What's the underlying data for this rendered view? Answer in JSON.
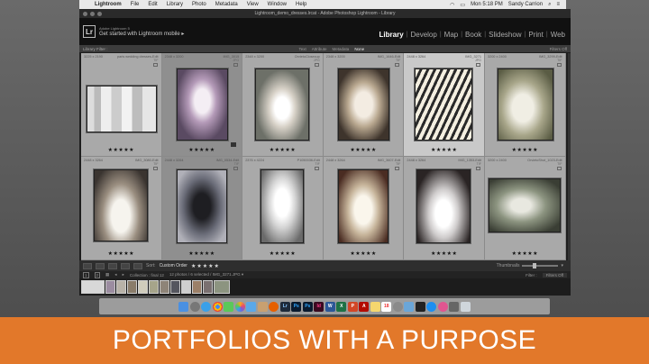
{
  "menubar": {
    "items": [
      "Lightroom",
      "File",
      "Edit",
      "Library",
      "Photo",
      "Metadata",
      "View",
      "Window",
      "Help"
    ],
    "clock": "Mon 5:18 PM",
    "user": "Sandy Carrion"
  },
  "window": {
    "title": "Lightroom_demo_dresses.lrcat - Adobe Photoshop Lightroom - Library"
  },
  "identity": {
    "logo": "Lr",
    "line1": "Adobe Lightroom 5",
    "line2": "Get started with Lightroom mobile ▸"
  },
  "modules": [
    "Library",
    "Develop",
    "Map",
    "Book",
    "Slideshow",
    "Print",
    "Web"
  ],
  "active_module": "Library",
  "filterbar": {
    "title": "Library Filter :",
    "options": [
      "Text",
      "Attribute",
      "Metadata",
      "None"
    ],
    "active": "None",
    "preset": "Filters Off"
  },
  "grid": {
    "cells": [
      {
        "name": "paris wedding dresses-Edit",
        "dims": "3225 x 2190",
        "ext": "TIF",
        "stars": "★★★★★"
      },
      {
        "name": "IMG_3015",
        "dims": "2348 x 3200",
        "ext": "JPG",
        "stars": "★★★★★"
      },
      {
        "name": "OrvietoClosecup",
        "dims": "2348 x 3200",
        "ext": "JPG",
        "stars": "★★★★★"
      },
      {
        "name": "IMG_1646-Edit",
        "dims": "2348 x 3200",
        "ext": "TIF",
        "stars": "★★★★★"
      },
      {
        "name": "IMG_3271",
        "dims": "2448 x 3264",
        "ext": "JPG",
        "stars": "★★★★★"
      },
      {
        "name": "IMG_3299-Edit",
        "dims": "3200 x 2400",
        "ext": "TIF",
        "stars": "★★★★★"
      },
      {
        "name": "IMG_3080-Edit",
        "dims": "2448 x 3264",
        "ext": "TIF",
        "stars": "★★★★★"
      },
      {
        "name": "IMG_0534-Edit",
        "dims": "2448 x 3264",
        "ext": "TIF",
        "stars": "★★★★★"
      },
      {
        "name": "P1050036-Edit",
        "dims": "2376 x 4224",
        "ext": "TIF",
        "stars": "★★★★★"
      },
      {
        "name": "IMG_3607-Edit",
        "dims": "2448 x 3264",
        "ext": "TIF",
        "stars": "★★★★★"
      },
      {
        "name": "IMG_1353-Edit",
        "dims": "2448 x 3264",
        "ext": "TIF",
        "stars": "★★★★★"
      },
      {
        "name": "OrvietoShot_1023-Edit",
        "dims": "3200 x 2400",
        "ext": "TIF",
        "stars": "★★★★★"
      }
    ]
  },
  "toolbar": {
    "sort_label": "Sort:",
    "sort_value": "Custom Order",
    "rating": "★★★★★",
    "thumbnails_label": "Thumbnails"
  },
  "filmstrip": {
    "pages": [
      "1",
      "2"
    ],
    "collection": "Collection : final 12",
    "status": "12 photos / 6 selected / IMG_3271.JPG ▾",
    "filter_label": "Filter :",
    "filter_value": "Filters Off"
  },
  "dock_icons": [
    "Finder",
    "Launchpad",
    "Safari",
    "Chrome",
    "Messages",
    "Photos",
    "Mail",
    "Contacts",
    "Firefox",
    "Lightroom",
    "Photoshop",
    "Photoshop2",
    "InDesign",
    "Word",
    "Excel",
    "PowerPoint",
    "Acrobat",
    "Notes",
    "Calendar",
    "System Prefs",
    "Preview",
    "Terminal",
    "App Store",
    "iTunes",
    "Camera",
    "Bin"
  ],
  "banner": {
    "text": "PORTFOLIOS WITH A PURPOSE"
  },
  "colors": {
    "banner": "#e2782a",
    "grid_bg": "#9a9a9a",
    "selected_cell": "#c9c9c9"
  }
}
